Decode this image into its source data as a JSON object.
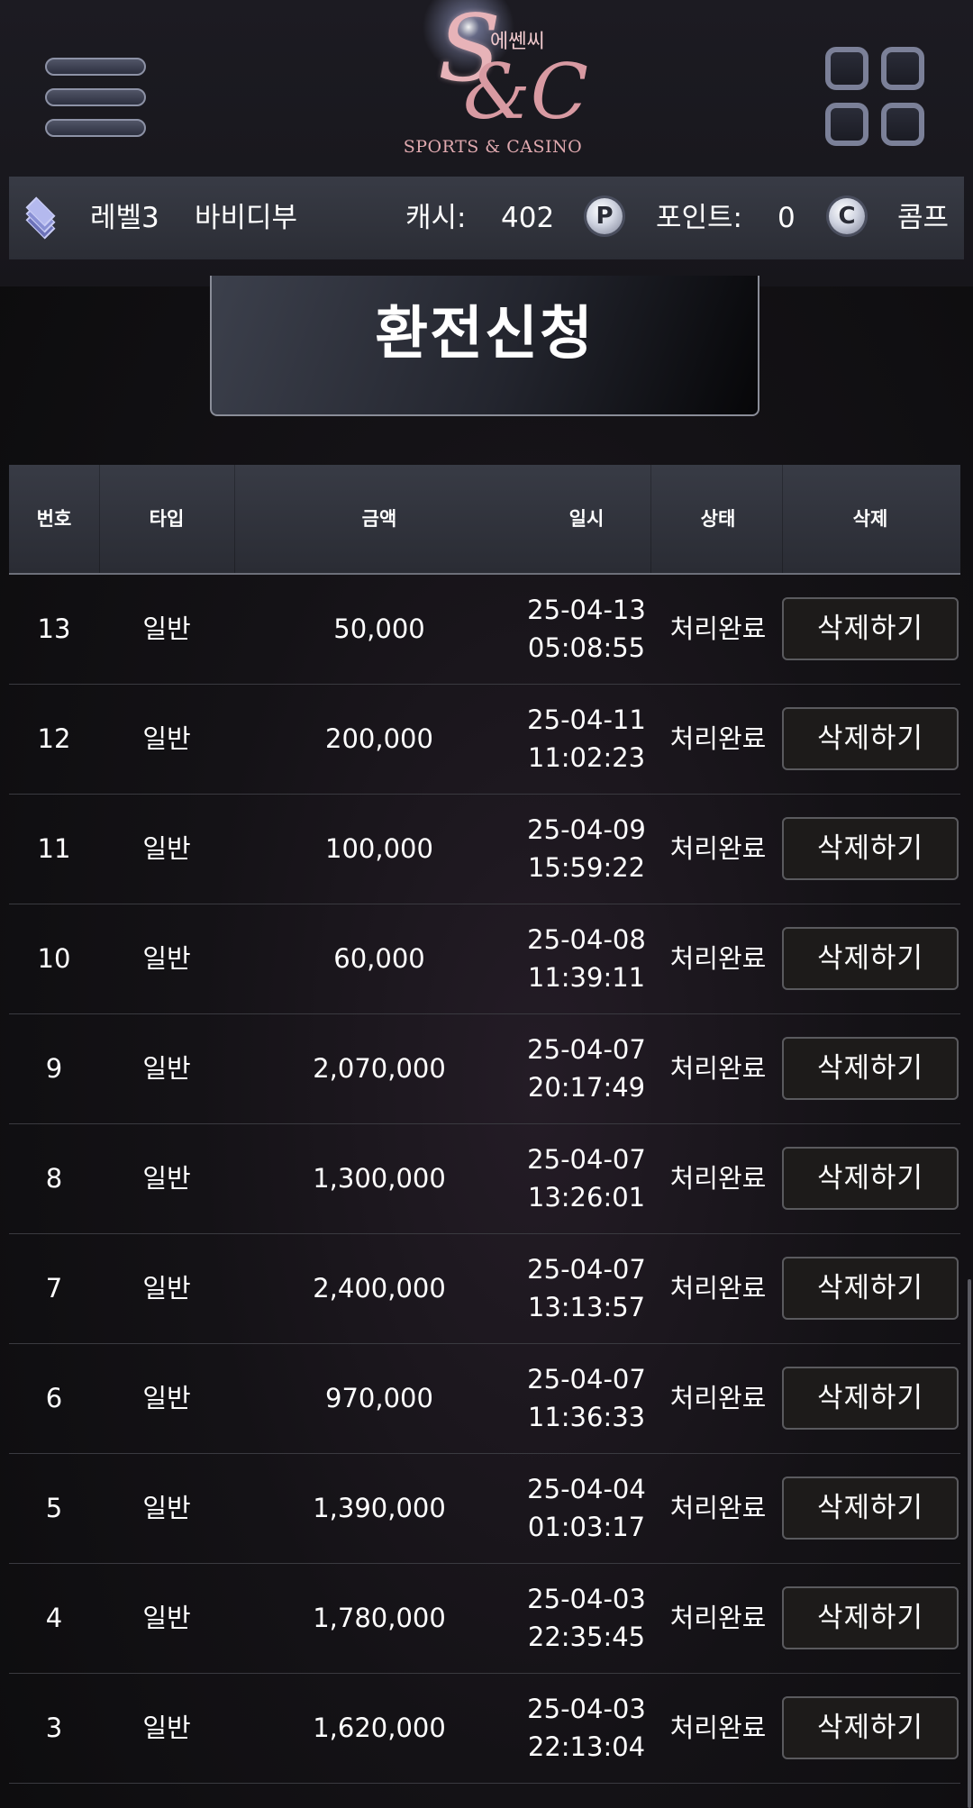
{
  "header": {
    "logo_monogram_top": "S",
    "logo_monogram_bottom": "&C",
    "logo_korean": "에쎈씨",
    "logo_subtitle": "SPORTS & CASINO"
  },
  "infobar": {
    "level": "레벨3",
    "username": "바비디부",
    "cash_label": "캐시:",
    "cash_value": "402",
    "point_icon_letter": "P",
    "point_label": "포인트:",
    "point_value": "0",
    "comp_icon_letter": "C",
    "comp_label": "콤프"
  },
  "page_title": "환전신청",
  "table": {
    "headers": {
      "no": "번호",
      "type": "타입",
      "amount": "금액",
      "datetime": "일시",
      "status": "상태",
      "delete": "삭제"
    },
    "rows": [
      {
        "no": "13",
        "type": "일반",
        "amount": "50,000",
        "date": "25-04-13",
        "time": "05:08:55",
        "status": "처리완료",
        "action": "삭제하기"
      },
      {
        "no": "12",
        "type": "일반",
        "amount": "200,000",
        "date": "25-04-11",
        "time": "11:02:23",
        "status": "처리완료",
        "action": "삭제하기"
      },
      {
        "no": "11",
        "type": "일반",
        "amount": "100,000",
        "date": "25-04-09",
        "time": "15:59:22",
        "status": "처리완료",
        "action": "삭제하기"
      },
      {
        "no": "10",
        "type": "일반",
        "amount": "60,000",
        "date": "25-04-08",
        "time": "11:39:11",
        "status": "처리완료",
        "action": "삭제하기"
      },
      {
        "no": "9",
        "type": "일반",
        "amount": "2,070,000",
        "date": "25-04-07",
        "time": "20:17:49",
        "status": "처리완료",
        "action": "삭제하기"
      },
      {
        "no": "8",
        "type": "일반",
        "amount": "1,300,000",
        "date": "25-04-07",
        "time": "13:26:01",
        "status": "처리완료",
        "action": "삭제하기"
      },
      {
        "no": "7",
        "type": "일반",
        "amount": "2,400,000",
        "date": "25-04-07",
        "time": "13:13:57",
        "status": "처리완료",
        "action": "삭제하기"
      },
      {
        "no": "6",
        "type": "일반",
        "amount": "970,000",
        "date": "25-04-07",
        "time": "11:36:33",
        "status": "처리완료",
        "action": "삭제하기"
      },
      {
        "no": "5",
        "type": "일반",
        "amount": "1,390,000",
        "date": "25-04-04",
        "time": "01:03:17",
        "status": "처리완료",
        "action": "삭제하기"
      },
      {
        "no": "4",
        "type": "일반",
        "amount": "1,780,000",
        "date": "25-04-03",
        "time": "22:35:45",
        "status": "처리완료",
        "action": "삭제하기"
      },
      {
        "no": "3",
        "type": "일반",
        "amount": "1,620,000",
        "date": "25-04-03",
        "time": "22:13:04",
        "status": "처리완료",
        "action": "삭제하기"
      }
    ]
  },
  "colors": {
    "background": "#141216",
    "header_bar": "#383b45",
    "button_bg": "#1d1b1a",
    "logo_pink": "#e7b3b8"
  }
}
